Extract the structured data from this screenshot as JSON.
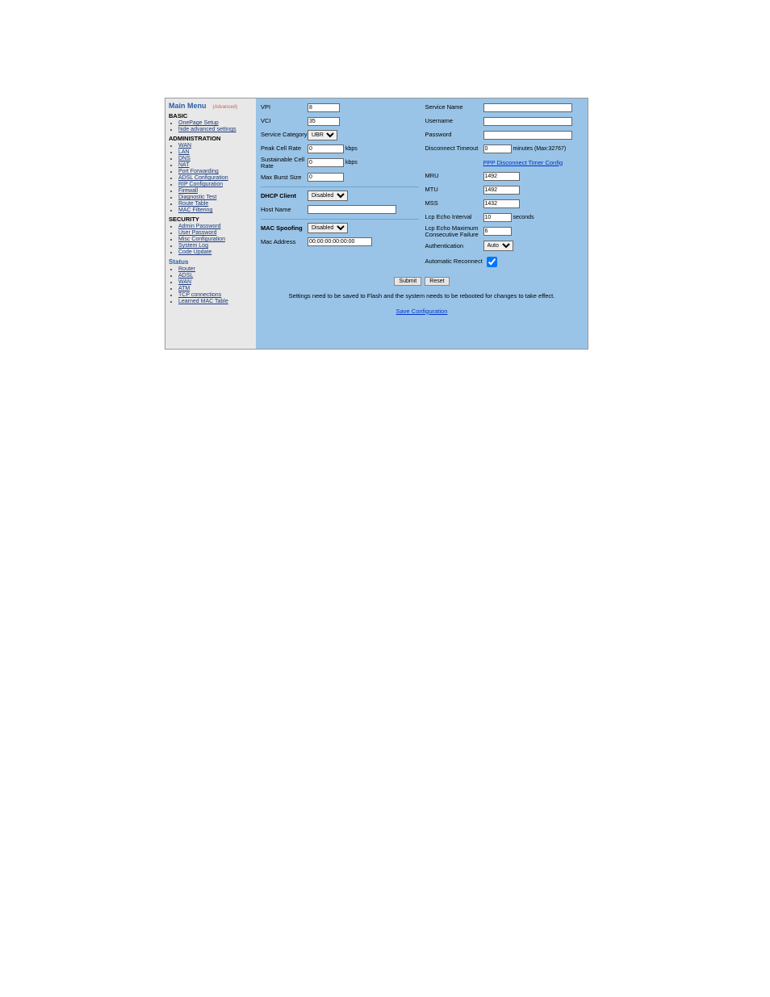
{
  "sidebar": {
    "title": "Main Menu",
    "subtitle": "(Advanced)",
    "sections": {
      "basic": {
        "header": "BASIC",
        "items": [
          "OnePage Setup",
          "hide advanced settings"
        ]
      },
      "admin": {
        "header": "ADMINISTRATION",
        "items": [
          "WAN",
          "LAN",
          "DNS",
          "NAT",
          "Port Forwarding",
          "ADSL Configuration",
          "RIP Configuration",
          "Firewall",
          "Diagnostic Test",
          "Route Table",
          "MAC Filtering"
        ]
      },
      "security": {
        "header": "SECURITY",
        "items": [
          "Admin Password",
          "User Password",
          "Misc Configuration",
          "System Log",
          "Code Update"
        ]
      }
    },
    "status": {
      "header": "Status",
      "items": [
        "Router",
        "ADSL",
        "WAN",
        "ATM",
        "TCP connections",
        "Learned MAC Table"
      ]
    }
  },
  "left": {
    "vpi": {
      "label": "VPI",
      "value": "8"
    },
    "vci": {
      "label": "VCI",
      "value": "35"
    },
    "serviceCategory": {
      "label": "Service Category",
      "value": "UBR"
    },
    "peakCellRate": {
      "label": "Peak Cell Rate",
      "value": "0",
      "unit": "kbps"
    },
    "sustainableCellRate": {
      "label": "Sustainable Cell Rate",
      "value": "0",
      "unit": "kbps"
    },
    "maxBurstSize": {
      "label": "Max Burst Size",
      "value": "0"
    },
    "dhcpClient": {
      "label": "DHCP Client",
      "value": "Disabled"
    },
    "hostName": {
      "label": "Host Name",
      "value": ""
    },
    "macSpoofing": {
      "label": "MAC Spoofing",
      "value": "Disabled"
    },
    "macAddress": {
      "label": "Mac Address",
      "value": "00:00:00:00:00:00"
    }
  },
  "right": {
    "serviceName": {
      "label": "Service Name",
      "value": ""
    },
    "username": {
      "label": "Username",
      "value": ""
    },
    "password": {
      "label": "Password",
      "value": ""
    },
    "disconnectTimeout": {
      "label": "Disconnect Timeout",
      "value": "0",
      "unit": "minutes (Max:32767)"
    },
    "pppLink": "PPP Disconnect Timer Config",
    "mru": {
      "label": "MRU",
      "value": "1492"
    },
    "mtu": {
      "label": "MTU",
      "value": "1492"
    },
    "mss": {
      "label": "MSS",
      "value": "1432"
    },
    "lcpEchoInterval": {
      "label": "Lcp Echo Interval",
      "value": "10",
      "unit": "seconds"
    },
    "lcpMaxFail": {
      "label": "Lcp Echo Maximum Consecutive Failure",
      "value": "6"
    },
    "authentication": {
      "label": "Authentication",
      "value": "Auto"
    },
    "automaticReconnect": {
      "label": "Automatic Reconnect",
      "checked": true
    }
  },
  "buttons": {
    "submit": "Submit",
    "reset": "Reset"
  },
  "footer": {
    "note": "Settings need to be saved to Flash and the system needs to be rebooted for changes to take effect.",
    "save": "Save Configuration"
  }
}
